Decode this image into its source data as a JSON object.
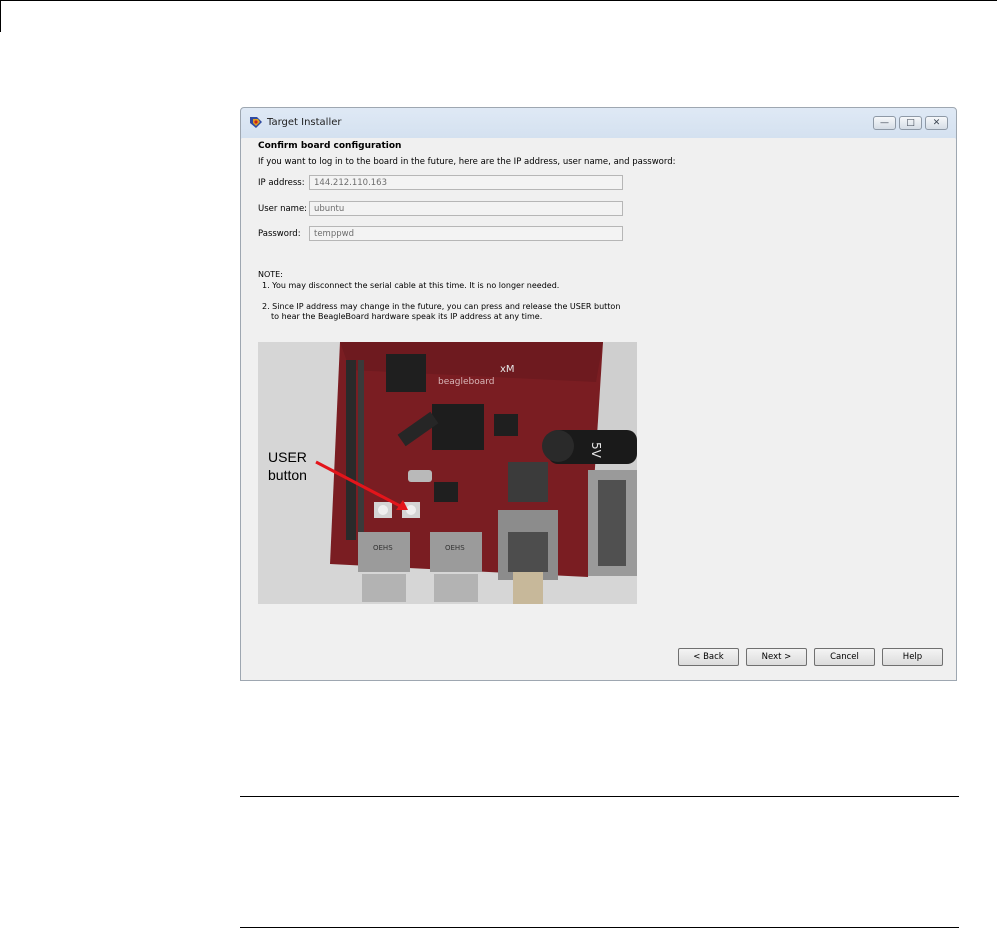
{
  "window": {
    "title": "Target Installer",
    "controls": {
      "minimize": "—",
      "maximize": "□",
      "close": "✕"
    }
  },
  "page": {
    "heading": "Confirm board configuration",
    "intro": "If you want to log in to the board in the future, here are the IP address, user name, and password:",
    "fields": [
      {
        "label": "IP address:",
        "value": "144.212.110.163"
      },
      {
        "label": "User name:",
        "value": "ubuntu"
      },
      {
        "label": "Password:",
        "value": "temppwd"
      }
    ],
    "note": {
      "title": "NOTE:",
      "item1": "1. You may disconnect the serial cable at this time. It is no longer needed.",
      "item2_line1": "2. Since IP address may change in the future, you can press and release the USER button",
      "item2_line2": "to hear the BeagleBoard hardware speak its IP address at any time."
    }
  },
  "photo": {
    "annotation_line1": "USER",
    "annotation_line2": "button",
    "board_brand": "beagleboard",
    "board_model": "xM",
    "cable_label": "5V",
    "port_label_1": "OEHS",
    "port_label_2": "OEHS"
  },
  "buttons": {
    "back": "< Back",
    "next": "Next >",
    "cancel": "Cancel",
    "help": "Help"
  },
  "colors": {
    "board_red": "#7a1d22",
    "arrow_red": "#e3151b",
    "dialog_bg": "#f0f0f0"
  }
}
